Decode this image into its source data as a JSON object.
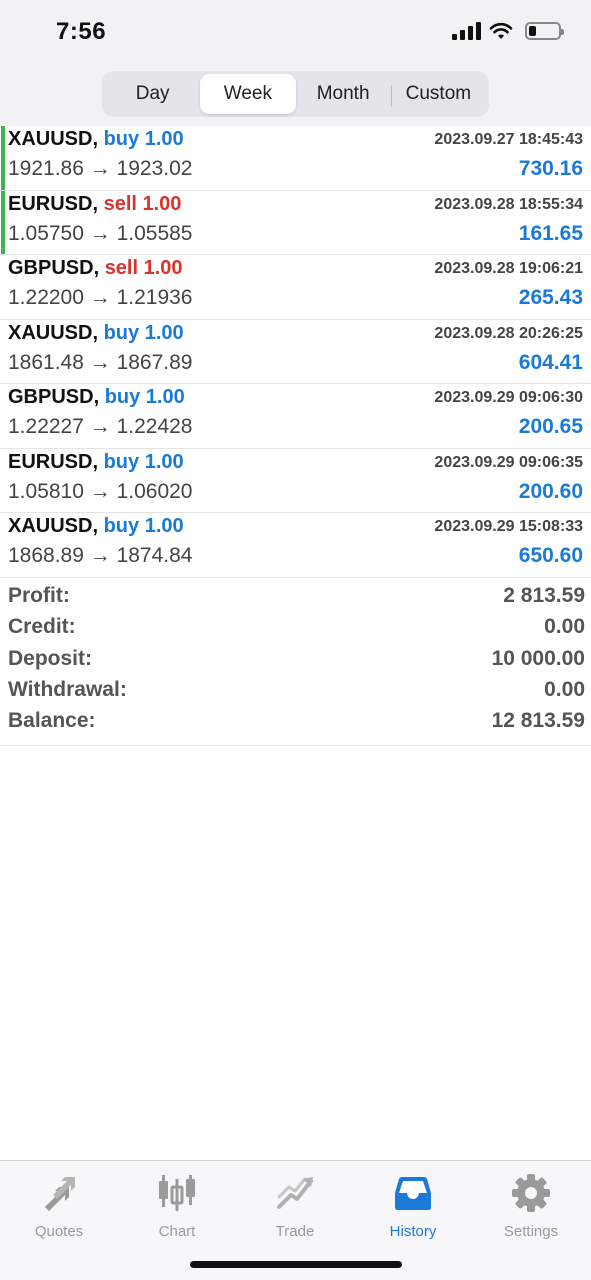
{
  "status_bar": {
    "time": "7:56"
  },
  "period_tabs": [
    {
      "label": "Day",
      "active": false
    },
    {
      "label": "Week",
      "active": true
    },
    {
      "label": "Month",
      "active": false
    },
    {
      "label": "Custom",
      "active": false
    }
  ],
  "trades": [
    {
      "symbol": "XAUUSD,",
      "direction": "buy 1.00",
      "type": "buy",
      "prices": "1921.86 → 1923.02",
      "datetime": "2023.09.27 18:45:43",
      "profit": "730.16"
    },
    {
      "symbol": "EURUSD,",
      "direction": "sell 1.00",
      "type": "sell",
      "prices": "1.05750 → 1.05585",
      "datetime": "2023.09.28 18:55:34",
      "profit": "161.65"
    },
    {
      "symbol": "GBPUSD,",
      "direction": "sell 1.00",
      "type": "sell",
      "prices": "1.22200 → 1.21936",
      "datetime": "2023.09.28 19:06:21",
      "profit": "265.43"
    },
    {
      "symbol": "XAUUSD,",
      "direction": "buy 1.00",
      "type": "buy",
      "prices": "1861.48 → 1867.89",
      "datetime": "2023.09.28 20:26:25",
      "profit": "604.41"
    },
    {
      "symbol": "GBPUSD,",
      "direction": "buy 1.00",
      "type": "buy",
      "prices": "1.22227 → 1.22428",
      "datetime": "2023.09.29 09:06:30",
      "profit": "200.65"
    },
    {
      "symbol": "EURUSD,",
      "direction": "buy 1.00",
      "type": "buy",
      "prices": "1.05810 → 1.06020",
      "datetime": "2023.09.29 09:06:35",
      "profit": "200.60"
    },
    {
      "symbol": "XAUUSD,",
      "direction": "buy 1.00",
      "type": "buy",
      "prices": "1868.89 → 1874.84",
      "datetime": "2023.09.29 15:08:33",
      "profit": "650.60"
    }
  ],
  "summary": [
    {
      "label": "Profit:",
      "value": "2 813.59"
    },
    {
      "label": "Credit:",
      "value": "0.00"
    },
    {
      "label": "Deposit:",
      "value": "10 000.00"
    },
    {
      "label": "Withdrawal:",
      "value": "0.00"
    },
    {
      "label": "Balance:",
      "value": "12 813.59"
    }
  ],
  "tab_bar": [
    {
      "label": "Quotes",
      "icon": "quotes-arrows-icon",
      "active": false
    },
    {
      "label": "Chart",
      "icon": "candlestick-chart-icon",
      "active": false
    },
    {
      "label": "Trade",
      "icon": "trade-trend-icon",
      "active": false
    },
    {
      "label": "History",
      "icon": "history-tray-icon",
      "active": true
    },
    {
      "label": "Settings",
      "icon": "gear-icon",
      "active": false
    }
  ],
  "colors": {
    "buy": "#1b7ad8",
    "sell": "#d9342b",
    "accent_bar": "#3fb34f",
    "active_tab": "#1b7ad8",
    "inactive_tab": "#9a9a9a"
  }
}
